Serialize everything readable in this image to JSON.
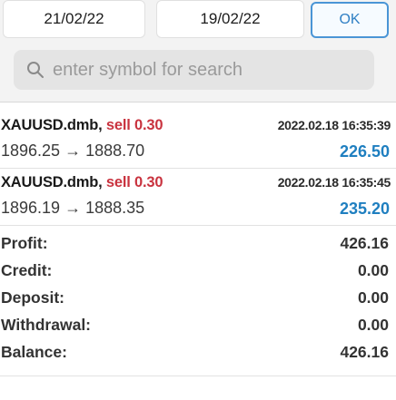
{
  "filter": {
    "date_from": "21/02/22",
    "date_to": "19/02/22",
    "ok_label": "OK"
  },
  "search": {
    "placeholder": "enter symbol for search",
    "icon": "search-icon"
  },
  "deals": [
    {
      "symbol": "XAUUSD.dmb,",
      "side": "sell 0.30",
      "time": "2022.02.18 16:35:39",
      "prices": "1896.25 → 1888.70",
      "profit": "226.50"
    },
    {
      "symbol": "XAUUSD.dmb,",
      "side": "sell 0.30",
      "time": "2022.02.18 16:35:45",
      "prices": "1896.19 → 1888.35",
      "profit": "235.20"
    }
  ],
  "summary": {
    "profit_label": "Profit:",
    "profit_value": "426.16",
    "credit_label": "Credit:",
    "credit_value": "0.00",
    "deposit_label": "Deposit:",
    "deposit_value": "0.00",
    "withdrawal_label": "Withdrawal:",
    "withdrawal_value": "0.00",
    "balance_label": "Balance:",
    "balance_value": "426.16"
  },
  "colors": {
    "sell": "#c9333f",
    "profit": "#1f7fc0",
    "ok_border": "#4a95d6"
  }
}
